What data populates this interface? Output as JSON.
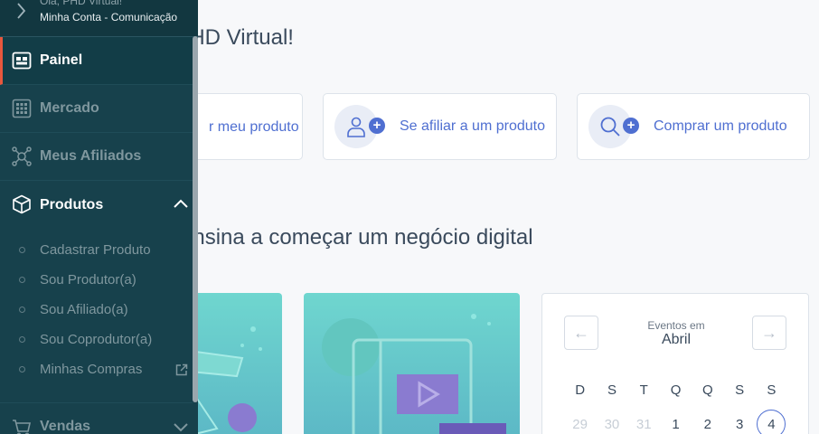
{
  "sidebar": {
    "account": {
      "greeting": "Olá, PHD Virtual!",
      "links": "Minha Conta - Comunicação"
    },
    "items": [
      {
        "label": "Painel",
        "icon": "dashboard-icon",
        "state": "active"
      },
      {
        "label": "Mercado",
        "icon": "grid-icon",
        "state": "normal"
      },
      {
        "label": "Meus Afiliados",
        "icon": "network-icon",
        "state": "normal"
      },
      {
        "label": "Produtos",
        "icon": "box-icon",
        "state": "expanded"
      }
    ],
    "products_submenu": [
      "Cadastrar Produto",
      "Sou Produtor(a)",
      "Sou Afiliado(a)",
      "Sou Coprodutor(a)",
      "Minhas Compras"
    ],
    "sales": {
      "label": "Vendas",
      "icon": "cart-icon"
    }
  },
  "main": {
    "greeting": ", PHD Virtual!",
    "actions": [
      {
        "label": "r meu produto",
        "icon": "box-plus-icon"
      },
      {
        "label": "Se afiliar a um produto",
        "icon": "user-plus-icon"
      },
      {
        "label": "Comprar um produto",
        "icon": "search-plus-icon"
      }
    ],
    "section_title": "e ensina a começar um negócio digital",
    "calendar": {
      "caption": "Eventos em",
      "month": "Abril",
      "weekdays": [
        "D",
        "S",
        "T",
        "Q",
        "Q",
        "S",
        "S"
      ],
      "days": [
        "29",
        "30",
        "31",
        "1",
        "2",
        "3",
        "4"
      ],
      "today": "4"
    }
  },
  "colors": {
    "sidebar_bg": "#17414c",
    "accent": "#4f6fd1",
    "active_marker": "#e8573d"
  }
}
